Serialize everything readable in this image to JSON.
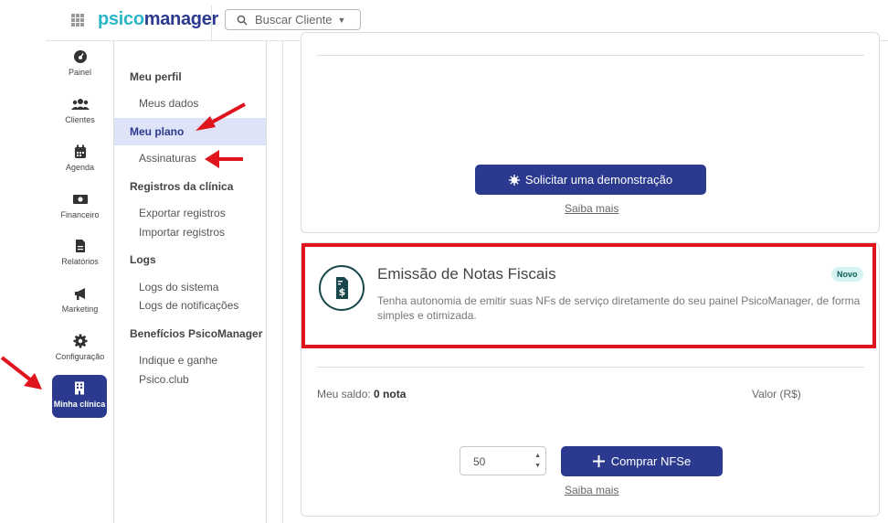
{
  "header": {
    "logo_part1": "psico",
    "logo_part2": "manager",
    "search_label": "Buscar Cliente"
  },
  "sidebar": {
    "items": [
      {
        "label": "Painel",
        "icon": "dashboard-icon"
      },
      {
        "label": "Clientes",
        "icon": "users-icon"
      },
      {
        "label": "Agenda",
        "icon": "calendar-icon"
      },
      {
        "label": "Financeiro",
        "icon": "money-icon"
      },
      {
        "label": "Relatórios",
        "icon": "file-icon"
      },
      {
        "label": "Marketing",
        "icon": "megaphone-icon"
      },
      {
        "label": "Configuração",
        "icon": "gear-icon"
      },
      {
        "label": "Minha clínica",
        "icon": "building-icon",
        "active": true
      }
    ]
  },
  "submenu": {
    "meu_perfil": "Meu perfil",
    "meus_dados": "Meus dados",
    "meu_plano": "Meu plano",
    "assinaturas": "Assinaturas",
    "registros": "Registros da clínica",
    "exportar": "Exportar registros",
    "importar": "Importar registros",
    "logs": "Logs",
    "logs_sistema": "Logs do sistema",
    "logs_notificacoes": "Logs de notificações",
    "beneficios": "Benefícios PsicoManager",
    "indique": "Indique e ganhe",
    "psicoclub": "Psico.club"
  },
  "card1": {
    "demo_button": "Solicitar uma demonstração",
    "saiba_mais": "Saiba mais"
  },
  "nf": {
    "title": "Emissão de Notas Fiscais",
    "badge": "Novo",
    "description": "Tenha autonomia de emitir suas NFs de serviço diretamente do seu painel PsicoManager, de forma simples e otimizada.",
    "saldo_label": "Meu saldo:",
    "saldo_value": "0 nota",
    "valor_label": "Valor (R$)",
    "quantity": "50",
    "buy_button": "Comprar NFSe",
    "saiba_mais": "Saiba mais"
  },
  "colors": {
    "brand_primary": "#2b3a8e",
    "brand_accent": "#2bb5c9",
    "highlight_red": "#e0141c",
    "badge_bg": "#d5f3f1"
  }
}
